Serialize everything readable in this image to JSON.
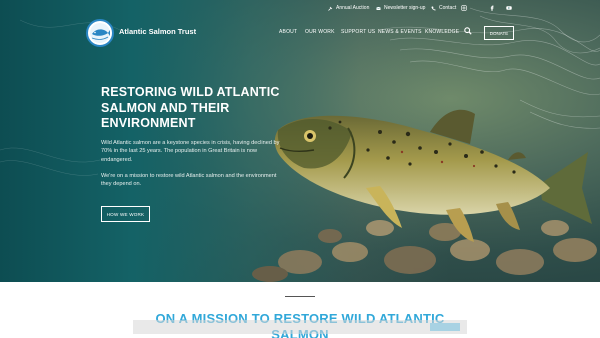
{
  "utility_nav": {
    "auction": "Annual Auction",
    "newsletter": "Newsletter sign-up",
    "contact": "Contact"
  },
  "social_icons": [
    "instagram-icon",
    "facebook-icon",
    "youtube-icon"
  ],
  "header": {
    "brand": "Atlantic Salmon Trust",
    "nav": [
      "ABOUT",
      "OUR WORK",
      "SUPPORT US",
      "NEWS & EVENTS",
      "KNOWLEDGE"
    ],
    "donate": "DONATE"
  },
  "hero": {
    "title": "RESTORING WILD ATLANTIC SALMON AND THEIR ENVIRONMENT",
    "paragraph1": "Wild Atlantic salmon are a keystone species in crisis, having declined by 70% in the last 25 years. The population in Great Britain is now  endangered.",
    "paragraph2": "We're on a mission to restore wild Atlantic salmon and the environment they depend on.",
    "button": "HOW WE WORK"
  },
  "mission": {
    "heading": "ON A MISSION TO RESTORE WILD ATLANTIC SALMON"
  },
  "colors": {
    "accent_blue": "#31a8d9",
    "hero_teal": "#146266"
  }
}
